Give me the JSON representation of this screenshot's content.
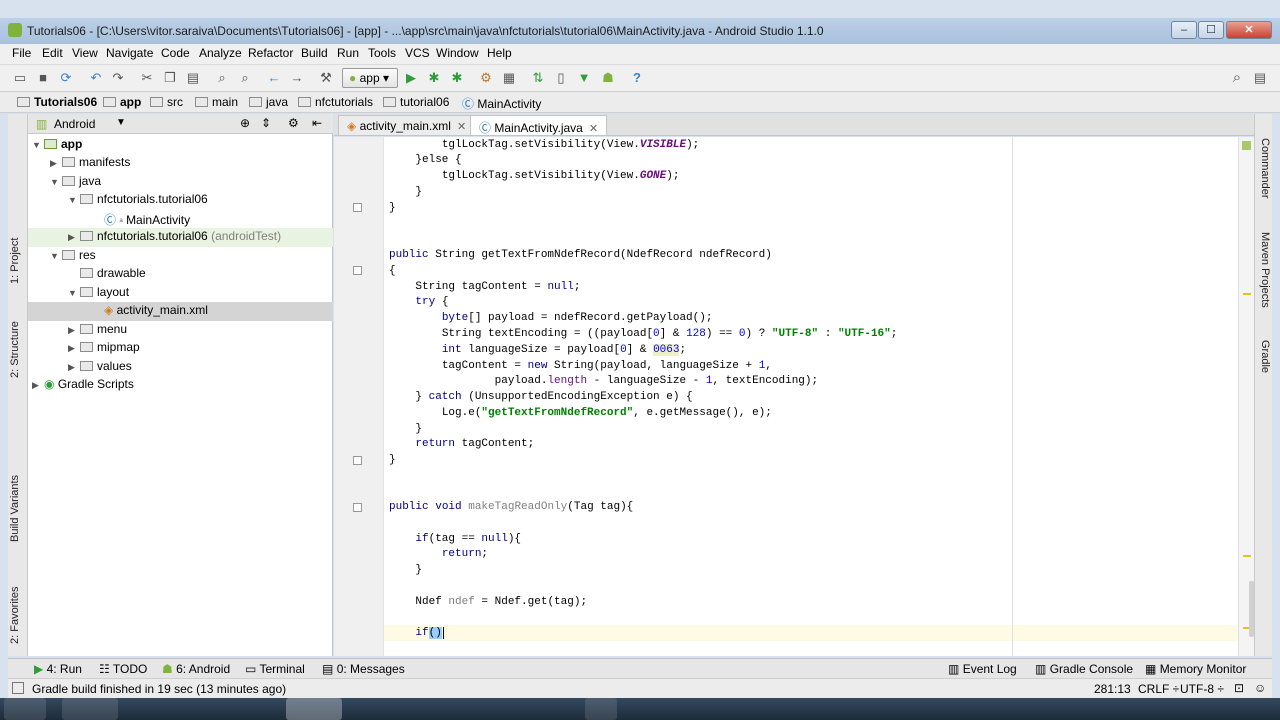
{
  "window": {
    "title": "Tutorials06 - [C:\\Users\\vitor.saraiva\\Documents\\Tutorials06] - [app] - ...\\app\\src\\main\\java\\nfctutorials\\tutorial06\\MainActivity.java - Android Studio 1.1.0",
    "controls": {
      "minimize": "–",
      "maximize": "☐",
      "close": "✕"
    }
  },
  "menu": [
    "File",
    "Edit",
    "View",
    "Navigate",
    "Code",
    "Analyze",
    "Refactor",
    "Build",
    "Run",
    "Tools",
    "VCS",
    "Window",
    "Help"
  ],
  "toolbar": {
    "run_config": "app"
  },
  "breadcrumb": [
    "Tutorials06",
    "app",
    "src",
    "main",
    "java",
    "nfctutorials",
    "tutorial06",
    "MainActivity"
  ],
  "project": {
    "view_mode": "Android",
    "tree": [
      {
        "label": "app",
        "extra": ""
      },
      {
        "label": "manifests",
        "extra": ""
      },
      {
        "label": "java",
        "extra": ""
      },
      {
        "label": "nfctutorials.tutorial06",
        "extra": ""
      },
      {
        "label": "MainActivity",
        "extra": ""
      },
      {
        "label": "nfctutorials.tutorial06",
        "extra": "(androidTest)"
      },
      {
        "label": "res",
        "extra": ""
      },
      {
        "label": "drawable",
        "extra": ""
      },
      {
        "label": "layout",
        "extra": ""
      },
      {
        "label": "activity_main.xml",
        "extra": ""
      },
      {
        "label": "menu",
        "extra": ""
      },
      {
        "label": "mipmap",
        "extra": ""
      },
      {
        "label": "values",
        "extra": ""
      },
      {
        "label": "Gradle Scripts",
        "extra": ""
      }
    ]
  },
  "tabs": [
    {
      "label": "activity_main.xml",
      "active": false
    },
    {
      "label": "MainActivity.java",
      "active": true
    }
  ],
  "side_tabs": {
    "left": [
      "1: Project",
      "2: Structure",
      "Build Variants",
      "2: Favorites"
    ],
    "right": [
      "Commander",
      "Maven Projects",
      "Gradle"
    ]
  },
  "bottom_tabs": [
    "4: Run",
    "TODO",
    "6: Android",
    "Terminal",
    "0: Messages",
    "Event Log",
    "Gradle Console",
    "Memory Monitor"
  ],
  "status": {
    "message": "Gradle build finished in 19 sec (13 minutes ago)",
    "position": "281:13",
    "line_sep": "CRLF ÷",
    "encoding": "UTF-8 ÷"
  },
  "code": {
    "l1": "tglLockTag.setVisibility(View.",
    "l1c": "VISIBLE",
    "l1e": ");",
    "l2a": "}else {",
    "l3": "tglLockTag.setVisibility(View.",
    "l3c": "GONE",
    "l3e": ");",
    "l4": "}",
    "l5": "}",
    "l6kw": "public",
    "l6": " String getTextFromNdefRecord(NdefRecord ndefRecord)",
    "l7": "{",
    "l8": "String tagContent = ",
    "l8kw": "null",
    "l8e": ";",
    "l9kw": "try",
    "l9": " {",
    "l10kw": "byte",
    "l10": "[] payload = ndefRecord.getPayload();",
    "l11": "String textEncoding = ((payload[",
    "l11n0": "0",
    "l11b": "] & ",
    "l11n1": "128",
    "l11c": ") == ",
    "l11n2": "0",
    "l11d": ") ? ",
    "l11s1": "\"UTF-8\"",
    "l11e": " : ",
    "l11s2": "\"UTF-16\"",
    "l11f": ";",
    "l12kw": "int",
    "l12": " languageSize = payload[",
    "l12n0": "0",
    "l12b": "] & ",
    "l12n1": "0063",
    "l12e": ";",
    "l13": "tagContent = ",
    "l13kw": "new",
    "l13b": " String(payload, languageSize + ",
    "l13n": "1",
    "l13e": ",",
    "l14": "payload.",
    "l14f": "length",
    "l14b": " - languageSize - ",
    "l14n": "1",
    "l14e": ", textEncoding);",
    "l15": "} ",
    "l15kw": "catch",
    "l15b": " (UnsupportedEncodingException e) {",
    "l16": "Log.e(",
    "l16s": "\"getTextFromNdefRecord\"",
    "l16e": ", e.getMessage(), e);",
    "l17": "}",
    "l18kw": "return",
    "l18": " tagContent;",
    "l19": "}",
    "l20kw1": "public",
    "l20kw2": "void",
    "l20m": "makeTagReadOnly",
    "l20": "(Tag tag){",
    "l21kw": "if",
    "l21": "(tag == ",
    "l21n": "null",
    "l21e": "){",
    "l22kw": "return",
    "l22": ";",
    "l23": "}",
    "l24": "Ndef ",
    "l24v": "ndef",
    "l24e": " = Ndef.get(tag);",
    "l25kw": "if",
    "l25": "()"
  }
}
